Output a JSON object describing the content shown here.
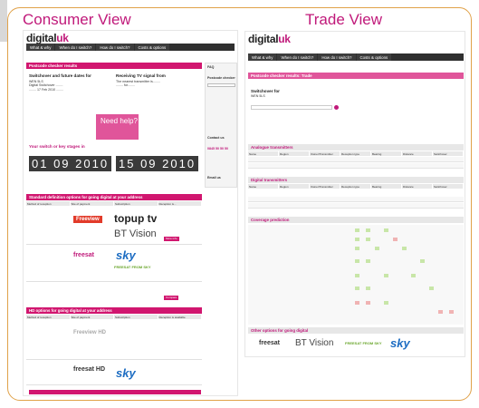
{
  "consumer": {
    "view_title": "Consumer View",
    "logo": {
      "a": "digital",
      "b": "uk"
    },
    "nav": [
      "What & why",
      "When do I switch?",
      "How do I switch?",
      "Costs & options"
    ],
    "header_bar": "Postcode checker results",
    "left_title": "Switchover and future dates for",
    "right_title": "Receiving TV signal from",
    "help_title": "Need help?",
    "region_text": "Your switch or key stages in",
    "date_left": "01 09 2010",
    "date_right": "15 09 2010",
    "standard_bar": "Standard definition options for going digital at your address",
    "standard_cols": [
      "Method of reception",
      "Site of payment",
      "Subscription",
      "Reception is...",
      "Reception is available"
    ],
    "standard_logos": [
      "Freeview",
      "topup tv",
      "BT Vision",
      "freesat",
      "sky",
      "FREESAT FROM SKY"
    ],
    "hd_bar": "HD options for going digital at your address",
    "hd_cols": [
      "Method of reception",
      "Site of payment",
      "Subscription",
      "Reception is available"
    ],
    "hd_logos": [
      "Freeview HD",
      "freesat HD",
      "sky"
    ],
    "side_titles": [
      "FAQ",
      "Postcode checker",
      "Contact us",
      "0845 50 50 50",
      "Email us"
    ]
  },
  "trade": {
    "view_title": "Trade View",
    "logo": {
      "a": "digital",
      "b": "uk"
    },
    "nav": [
      "What & why",
      "When do I switch?",
      "How do I switch?",
      "Costs & options"
    ],
    "header_bar": "Postcode checker results: Trade",
    "switchover_for": "Switchover for",
    "analogue_bar": "Analogue transmitters",
    "digital_bar": "Digital transmitters",
    "coverage_bar": "Coverage prediction",
    "other_bar": "Other options for going digital",
    "logos": [
      "freesat",
      "BT Vision",
      "FREESAT FROM SKY",
      "sky"
    ],
    "table_cols": [
      "Name",
      "Region",
      "Owner/Transmitter",
      "Reception type",
      "Bearing",
      "Distance",
      "Switchover"
    ]
  }
}
